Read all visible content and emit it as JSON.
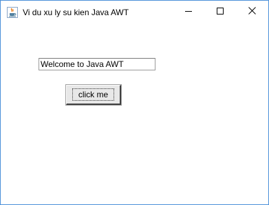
{
  "window": {
    "title": "Vi du xu ly su kien Java AWT",
    "border_color": "#4a8fd9",
    "icons": {
      "app": "java-cup-icon",
      "minimize": "minimize-icon",
      "maximize": "maximize-icon",
      "close": "close-icon"
    }
  },
  "content": {
    "textfield_value": "Welcome to Java AWT",
    "button_label": "click me"
  }
}
